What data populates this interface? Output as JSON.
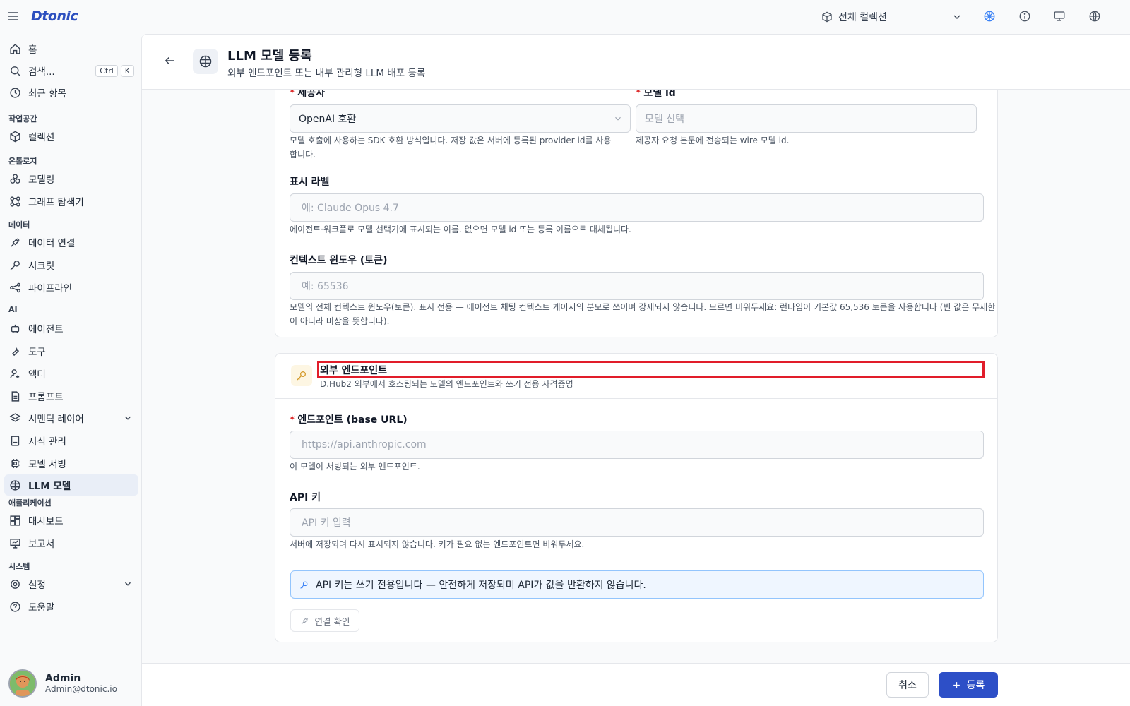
{
  "app": {
    "logo": "Dtonic"
  },
  "topbar": {
    "collection_label": "전체 컬렉션"
  },
  "search_shortcut": {
    "ctrl": "Ctrl",
    "key": "K"
  },
  "sidebar": {
    "home": "홈",
    "search": "검색...",
    "recent": "최근 항목",
    "sections": {
      "workspace": "작업공간",
      "ontology": "온톨로지",
      "data": "데이터",
      "ai": "AI",
      "apps": "애플리케이션",
      "system": "시스템"
    },
    "items": {
      "collection": "컬렉션",
      "modeling": "모델링",
      "graph_explorer": "그래프 탐색기",
      "data_connection": "데이터 연결",
      "secret": "시크릿",
      "pipeline": "파이프라인",
      "agent": "에이전트",
      "tool": "도구",
      "actor": "액터",
      "prompt": "프롬프트",
      "semantic_layer": "시맨틱 레이어",
      "knowledge": "지식 관리",
      "model_serving": "모델 서빙",
      "llm_model": "LLM 모델",
      "dashboard": "대시보드",
      "report": "보고서",
      "settings": "설정",
      "help": "도움말"
    }
  },
  "user": {
    "name": "Admin",
    "email": "Admin@dtonic.io"
  },
  "page": {
    "title": "LLM 모델 등록",
    "subtitle": "외부 엔드포인트 또는 내부 관리형 LLM 배포 등록"
  },
  "form": {
    "provider": {
      "label": "제공사",
      "value": "OpenAI 호환",
      "help": "모델 호출에 사용하는 SDK 호환 방식입니다. 저장 값은 서버에 등록된 provider id를 사용합니다."
    },
    "model_id": {
      "label": "모델 id",
      "placeholder": "모델 선택",
      "help": "제공자 요청 본문에 전송되는 wire 모델 id."
    },
    "display_label": {
      "label": "표시 라벨",
      "placeholder": "예: Claude Opus 4.7",
      "help": "에이전트·워크플로 모델 선택기에 표시되는 이름. 없으면 모델 id 또는 등록 이름으로 대체됩니다."
    },
    "context_window": {
      "label": "컨텍스트 윈도우 (토큰)",
      "placeholder": "예: 65536",
      "help": "모델의 전체 컨텍스트 윈도우(토큰). 표시 전용 — 에이전트 채팅 컨텍스트 게이지의 분모로 쓰이며 강제되지 않습니다. 모르면 비워두세요: 런타임이 기본값 65,536 토큰을 사용합니다 (빈 값은 무제한이 아니라 미상을 뜻합니다)."
    }
  },
  "external": {
    "title": "외부 엔드포인트",
    "subtitle": "D.Hub2 외부에서 호스팅되는 모델의 엔드포인트와 쓰기 전용 자격증명",
    "endpoint": {
      "label": "엔드포인트 (base URL)",
      "placeholder": "https://api.anthropic.com",
      "help": "이 모델이 서빙되는 외부 엔드포인트."
    },
    "api_key": {
      "label": "API 키",
      "placeholder": "API 키 입력",
      "help": "서버에 저장되며 다시 표시되지 않습니다. 키가 필요 없는 엔드포인트면 비워두세요."
    },
    "notice": "API 키는 쓰기 전용입니다 — 안전하게 저장되며 API가 값을 반환하지 않습니다.",
    "test_button": "연결 확인"
  },
  "footer": {
    "cancel": "취소",
    "submit": "등록"
  },
  "colors": {
    "accent": "#2d4fc7",
    "required": "#dc2626",
    "highlight": "#e11d2a"
  }
}
